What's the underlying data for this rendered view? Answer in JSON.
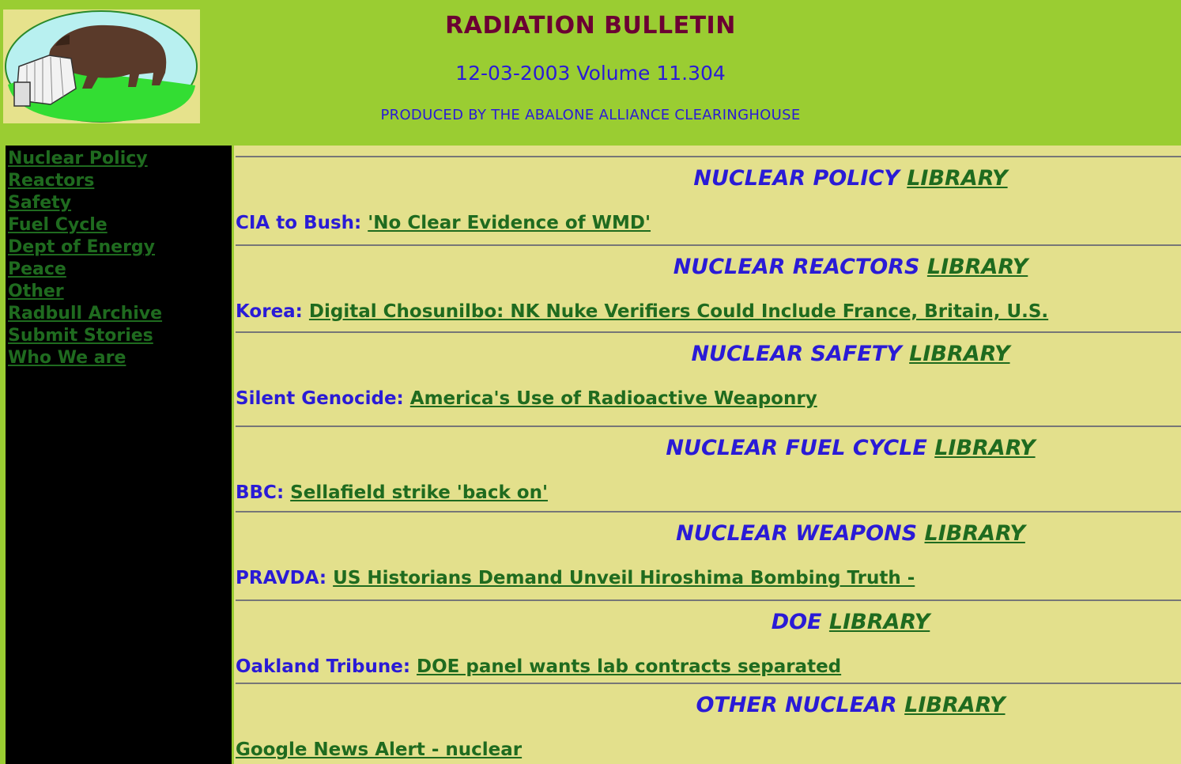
{
  "header": {
    "title": "RADIATION BULLETIN",
    "date_volume": "12-03-2003 Volume 11.304",
    "producer": "PRODUCED BY THE ABALONE ALLIANCE CLEARINGHOUSE",
    "logo_icon": "bison-reactor-logo-icon"
  },
  "sidebar": {
    "items": [
      {
        "label": "Nuclear Policy"
      },
      {
        "label": "Reactors"
      },
      {
        "label": "Safety"
      },
      {
        "label": "Fuel Cycle"
      },
      {
        "label": "Dept of Energy"
      },
      {
        "label": "Peace"
      },
      {
        "label": "Other"
      },
      {
        "label": "Radbull Archive"
      },
      {
        "label": "Submit Stories"
      },
      {
        "label": "Who We are"
      }
    ]
  },
  "sections": [
    {
      "heading": "NUCLEAR POLICY",
      "library": "LIBRARY",
      "source": "CIA to Bush:",
      "headline": "'No Clear Evidence of WMD'"
    },
    {
      "heading": "NUCLEAR REACTORS",
      "library": "LIBRARY",
      "source": "Korea:",
      "headline": "Digital Chosunilbo: NK Nuke Verifiers Could Include France, Britain, U.S."
    },
    {
      "heading": "NUCLEAR SAFETY",
      "library": "LIBRARY",
      "source": "Silent Genocide:",
      "headline": "America's Use of Radioactive Weaponry"
    },
    {
      "heading": "NUCLEAR FUEL CYCLE",
      "library": "LIBRARY",
      "source": "BBC:",
      "headline": "Sellafield strike 'back on'"
    },
    {
      "heading": "NUCLEAR WEAPONS",
      "library": "LIBRARY",
      "source": "PRAVDA:",
      "headline": "US Historians Demand Unveil Hiroshima Bombing Truth -"
    },
    {
      "heading": "DOE",
      "library": "LIBRARY",
      "source": "Oakland Tribune:",
      "headline": "DOE panel wants lab contracts separated"
    },
    {
      "heading": "OTHER NUCLEAR",
      "library": "LIBRARY",
      "source": "",
      "headline": "Google News Alert - nuclear"
    }
  ],
  "colors": {
    "page_background": "#9acd32",
    "content_background": "#e3e08c",
    "sidebar_background": "#000000",
    "title_color": "#6b0033",
    "accent_blue": "#2a1bd6",
    "link_green": "#1f6b1f"
  }
}
